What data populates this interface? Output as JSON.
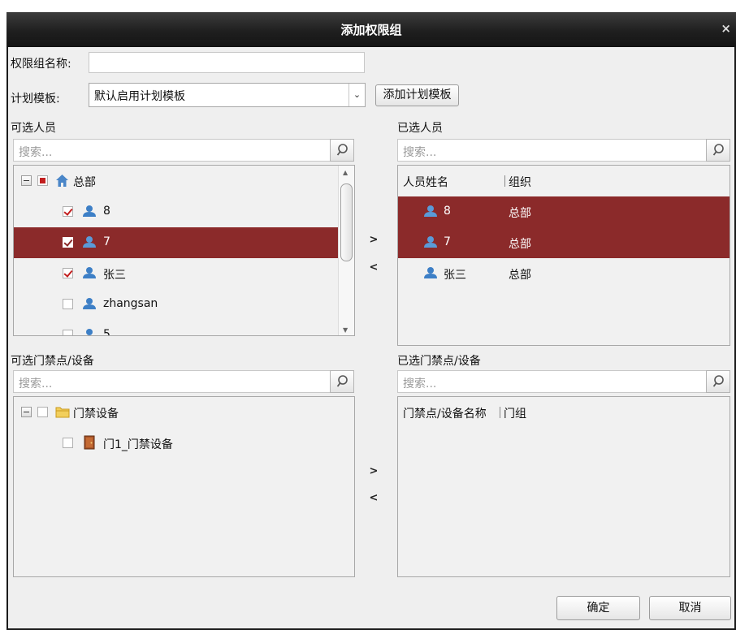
{
  "window": {
    "title": "添加权限组"
  },
  "form": {
    "group_name_label": "权限组名称:",
    "group_name_value": "",
    "plan_label": "计划模板:",
    "plan_value": "默认启用计划模板",
    "add_plan_label": "添加计划模板"
  },
  "available_people": {
    "title": "可选人员",
    "search_placeholder": "搜索...",
    "root": {
      "label": "总部",
      "state": "partial"
    },
    "items": [
      {
        "label": "8",
        "checked": true,
        "selected": false
      },
      {
        "label": "7",
        "checked": true,
        "selected": true
      },
      {
        "label": "张三",
        "checked": true,
        "selected": false
      },
      {
        "label": "zhangsan",
        "checked": false,
        "selected": false
      },
      {
        "label": "5",
        "checked": false,
        "selected": false
      }
    ]
  },
  "selected_people": {
    "title": "已选人员",
    "search_placeholder": "搜索...",
    "columns": [
      "人员姓名",
      "组织"
    ],
    "rows": [
      {
        "name": "8",
        "org": "总部",
        "selected": true
      },
      {
        "name": "7",
        "org": "总部",
        "selected": true
      },
      {
        "name": "张三",
        "org": "总部",
        "selected": false
      }
    ]
  },
  "transfer": {
    "add": ">",
    "remove": "<"
  },
  "available_doors": {
    "title": "可选门禁点/设备",
    "search_placeholder": "搜索...",
    "root": {
      "label": "门禁设备"
    },
    "items": [
      {
        "label": "门1_门禁设备"
      }
    ]
  },
  "selected_doors": {
    "title": "已选门禁点/设备",
    "search_placeholder": "搜索...",
    "columns": [
      "门禁点/设备名称",
      "门组"
    ]
  },
  "footer": {
    "ok_label": "确定",
    "cancel_label": "取消"
  },
  "colors": {
    "title_bar": "#1f1f1f",
    "selection": "#8b2a2a",
    "check": "#c21e1e",
    "person_icon": "#3d7fc6",
    "folder_icon": "#e8b83a",
    "door_icon": "#8a4a1f"
  }
}
